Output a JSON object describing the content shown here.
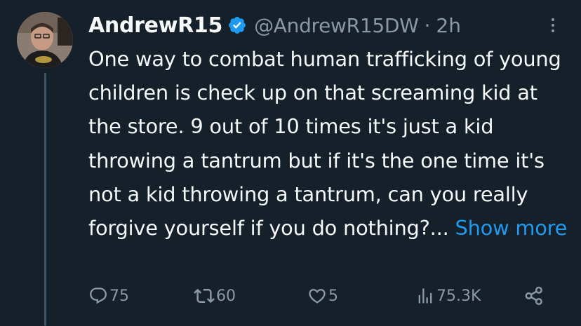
{
  "author": {
    "display_name": "AndrewR15",
    "verified": true,
    "handle": "@AndrewR15DW",
    "separator": "·",
    "timestamp": "2h"
  },
  "tweet": {
    "text": "One way to combat human trafficking of young children is check up on that screaming kid at the store. 9 out of 10 times it's just a kid throwing a tantrum but if it's the one time it's not a kid throwing a tantrum, can you really forgive yourself if you do nothing?...",
    "show_more": "Show more"
  },
  "actions": {
    "replies": "75",
    "retweets": "60",
    "likes": "5",
    "views": "75.3K"
  },
  "icons": {
    "verified": "verified-badge-icon",
    "more": "more-options-icon",
    "reply": "reply-icon",
    "retweet": "retweet-icon",
    "like": "heart-icon",
    "views": "views-icon",
    "share": "share-icon"
  },
  "colors": {
    "background": "#15202b",
    "text": "#f7f9f9",
    "secondary": "#8b98a5",
    "accent": "#1d9bf0"
  }
}
